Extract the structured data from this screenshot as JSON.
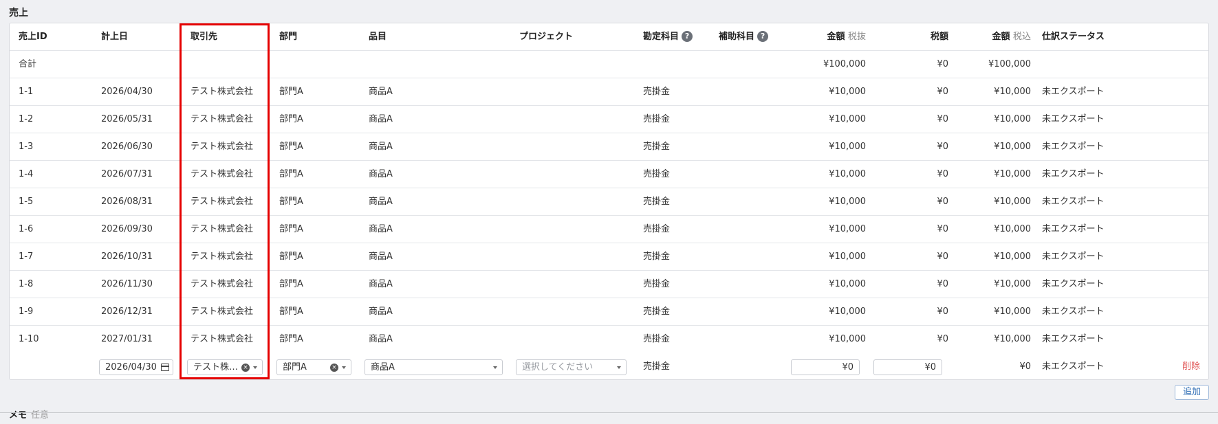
{
  "section_title": "売上",
  "columns": {
    "id": "売上ID",
    "date": "計上日",
    "partner": "取引先",
    "department": "部門",
    "item": "品目",
    "project": "プロジェクト",
    "account": "勘定科目",
    "sub_account": "補助科目",
    "amount_excl": "金額",
    "amount_excl_note": "税抜",
    "tax": "税額",
    "amount_incl": "金額",
    "amount_incl_note": "税込",
    "status": "仕訳ステータス"
  },
  "total_row": {
    "label": "合計",
    "amount_excl": "¥100,000",
    "tax": "¥0",
    "amount_incl": "¥100,000"
  },
  "rows": [
    {
      "id": "1-1",
      "date": "2026/04/30",
      "partner": "テスト株式会社",
      "department": "部門A",
      "item": "商品A",
      "account": "売掛金",
      "amount_excl": "¥10,000",
      "tax": "¥0",
      "amount_incl": "¥10,000",
      "status": "未エクスポート"
    },
    {
      "id": "1-2",
      "date": "2026/05/31",
      "partner": "テスト株式会社",
      "department": "部門A",
      "item": "商品A",
      "account": "売掛金",
      "amount_excl": "¥10,000",
      "tax": "¥0",
      "amount_incl": "¥10,000",
      "status": "未エクスポート"
    },
    {
      "id": "1-3",
      "date": "2026/06/30",
      "partner": "テスト株式会社",
      "department": "部門A",
      "item": "商品A",
      "account": "売掛金",
      "amount_excl": "¥10,000",
      "tax": "¥0",
      "amount_incl": "¥10,000",
      "status": "未エクスポート"
    },
    {
      "id": "1-4",
      "date": "2026/07/31",
      "partner": "テスト株式会社",
      "department": "部門A",
      "item": "商品A",
      "account": "売掛金",
      "amount_excl": "¥10,000",
      "tax": "¥0",
      "amount_incl": "¥10,000",
      "status": "未エクスポート"
    },
    {
      "id": "1-5",
      "date": "2026/08/31",
      "partner": "テスト株式会社",
      "department": "部門A",
      "item": "商品A",
      "account": "売掛金",
      "amount_excl": "¥10,000",
      "tax": "¥0",
      "amount_incl": "¥10,000",
      "status": "未エクスポート"
    },
    {
      "id": "1-6",
      "date": "2026/09/30",
      "partner": "テスト株式会社",
      "department": "部門A",
      "item": "商品A",
      "account": "売掛金",
      "amount_excl": "¥10,000",
      "tax": "¥0",
      "amount_incl": "¥10,000",
      "status": "未エクスポート"
    },
    {
      "id": "1-7",
      "date": "2026/10/31",
      "partner": "テスト株式会社",
      "department": "部門A",
      "item": "商品A",
      "account": "売掛金",
      "amount_excl": "¥10,000",
      "tax": "¥0",
      "amount_incl": "¥10,000",
      "status": "未エクスポート"
    },
    {
      "id": "1-8",
      "date": "2026/11/30",
      "partner": "テスト株式会社",
      "department": "部門A",
      "item": "商品A",
      "account": "売掛金",
      "amount_excl": "¥10,000",
      "tax": "¥0",
      "amount_incl": "¥10,000",
      "status": "未エクスポート"
    },
    {
      "id": "1-9",
      "date": "2026/12/31",
      "partner": "テスト株式会社",
      "department": "部門A",
      "item": "商品A",
      "account": "売掛金",
      "amount_excl": "¥10,000",
      "tax": "¥0",
      "amount_incl": "¥10,000",
      "status": "未エクスポート"
    },
    {
      "id": "1-10",
      "date": "2027/01/31",
      "partner": "テスト株式会社",
      "department": "部門A",
      "item": "商品A",
      "account": "売掛金",
      "amount_excl": "¥10,000",
      "tax": "¥0",
      "amount_incl": "¥10,000",
      "status": "未エクスポート"
    }
  ],
  "edit_row": {
    "date_value": "2026/04/30",
    "partner_value": "テスト株…",
    "department_value": "部門A",
    "item_value": "商品A",
    "project_placeholder": "選択してください",
    "account": "売掛金",
    "amount_excl_value": "¥0",
    "tax_value": "¥0",
    "amount_incl": "¥0",
    "status": "未エクスポート",
    "delete_label": "削除"
  },
  "help_icon_glyph": "?",
  "clear_icon_glyph": "×",
  "add_label": "追加",
  "memo_title": "メモ",
  "memo_note": "任意",
  "colors": {
    "highlight": "#e50000",
    "delete": "#e05656",
    "link": "#2f6db5"
  }
}
